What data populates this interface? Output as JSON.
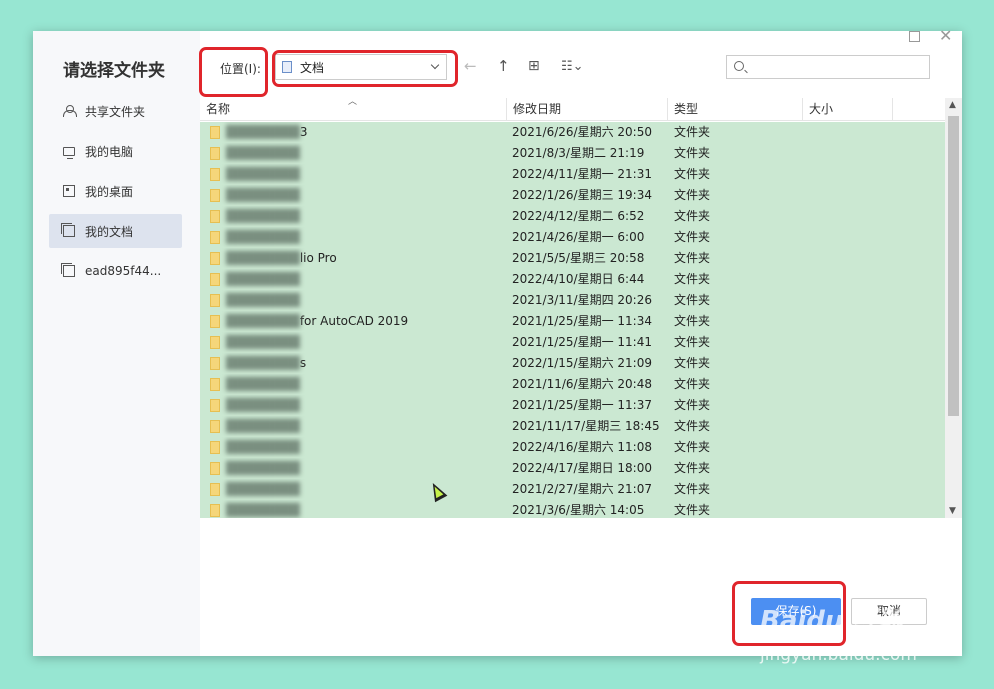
{
  "dialog": {
    "title": "请选择文件夹"
  },
  "sidebar": {
    "items": [
      {
        "label": "共享文件夹",
        "icon": "share-icon"
      },
      {
        "label": "我的电脑",
        "icon": "computer-icon"
      },
      {
        "label": "我的桌面",
        "icon": "desktop-icon"
      },
      {
        "label": "我的文档",
        "icon": "documents-icon",
        "active": true
      },
      {
        "label": "ead895f44...",
        "icon": "folder-icon"
      }
    ]
  },
  "toolbar": {
    "location_label": "位置(I):",
    "location_value": "文档",
    "search_placeholder": ""
  },
  "columns": {
    "name": "名称",
    "modified": "修改日期",
    "type": "类型",
    "size": "大小"
  },
  "files": [
    {
      "name": "3",
      "date": "2021/6/26/星期六 20:50",
      "type": "文件夹"
    },
    {
      "name": "",
      "date": "2021/8/3/星期二 21:19",
      "type": "文件夹"
    },
    {
      "name": "",
      "date": "2022/4/11/星期一 21:31",
      "type": "文件夹"
    },
    {
      "name": "",
      "date": "2022/1/26/星期三 19:34",
      "type": "文件夹"
    },
    {
      "name": "",
      "date": "2022/4/12/星期二 6:52",
      "type": "文件夹"
    },
    {
      "name": "",
      "date": "2021/4/26/星期一 6:00",
      "type": "文件夹"
    },
    {
      "name": "lio Pro",
      "date": "2021/5/5/星期三 20:58",
      "type": "文件夹"
    },
    {
      "name": "",
      "date": "2022/4/10/星期日 6:44",
      "type": "文件夹"
    },
    {
      "name": "",
      "date": "2021/3/11/星期四 20:26",
      "type": "文件夹"
    },
    {
      "name": "for AutoCAD 2019",
      "date": "2021/1/25/星期一 11:34",
      "type": "文件夹"
    },
    {
      "name": "",
      "date": "2021/1/25/星期一 11:41",
      "type": "文件夹"
    },
    {
      "name": "s",
      "date": "2022/1/15/星期六 21:09",
      "type": "文件夹"
    },
    {
      "name": "",
      "date": "2021/11/6/星期六 20:48",
      "type": "文件夹"
    },
    {
      "name": "",
      "date": "2021/1/25/星期一 11:37",
      "type": "文件夹"
    },
    {
      "name": "",
      "date": "2021/11/17/星期三 18:45",
      "type": "文件夹"
    },
    {
      "name": "",
      "date": "2022/4/16/星期六 11:08",
      "type": "文件夹"
    },
    {
      "name": "",
      "date": "2022/4/17/星期日 18:00",
      "type": "文件夹"
    },
    {
      "name": "",
      "date": "2021/2/27/星期六 21:07",
      "type": "文件夹"
    },
    {
      "name": "",
      "date": "2021/3/6/星期六 14:05",
      "type": "文件夹"
    }
  ],
  "buttons": {
    "save": "保存(S)",
    "cancel": "取消"
  },
  "watermark": {
    "main": "Baidu 经验",
    "sub": "jingyan.baidu.com"
  },
  "colors": {
    "highlight": "#e0252b",
    "selection": "#cbe8d2",
    "primary": "#4c8ff2",
    "background": "#97e6d2"
  }
}
